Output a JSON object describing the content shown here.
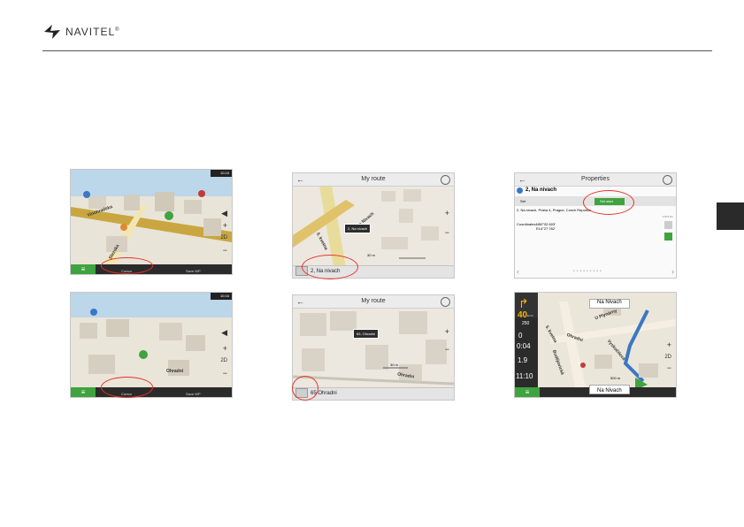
{
  "header": {
    "brand": "NAVITEL",
    "brand_mark": "®"
  },
  "colors": {
    "accent_green": "#3fa33f",
    "highlight_red": "#e8322c",
    "side_tab": "#2a2a2a"
  },
  "shot1": {
    "bottom_center": "Cursor",
    "bottom_right": "Save WP",
    "road_a": "Vinohradska",
    "road_b": "Slezska",
    "zoom_label": "2D",
    "status_time": "10:15"
  },
  "shot2": {
    "title": "My route",
    "callout": "2, Na nivach",
    "address": "2, Na nivach",
    "road_a": "Na Nivach",
    "road_b": "5. kvetna",
    "scale": "30 m"
  },
  "shot3": {
    "title": "Properties",
    "name": "2, Na nivach",
    "set_label": "Set",
    "set_start": "Set start",
    "address_line": "2, Na nivach, Praha 4, Prague, Czech Republic",
    "distance": "1.874 km",
    "coords_label": "Coordinates:",
    "coords_n": "N50°02.603'",
    "coords_e": "E14°27.782'"
  },
  "shot4": {
    "bottom_center": "Cursor",
    "bottom_right": "Save WP",
    "road_a": "Ohradni",
    "zoom_label": "2D",
    "status_time": "10:16"
  },
  "shot5": {
    "title": "My route",
    "callout": "65, Ohradni",
    "address": "65 Ohradni",
    "scale": "30 m",
    "road_a": "Ohradni"
  },
  "shot6": {
    "top_street": "Na Nivach",
    "bottom_street": "Na Nivach",
    "speed": "40",
    "speed_unit": "km/h",
    "turn_dist": "250",
    "dist_km": "0",
    "time_left": "0:04",
    "dist_total": "1.9",
    "clock": "11:10",
    "road_a": "U Plynárny",
    "road_b": "Ohradni",
    "road_c": "5. kvetna",
    "road_d": "Budějovická",
    "road_e": "Vyskočilova",
    "scale": "500 m",
    "zoom_label": "2D"
  }
}
